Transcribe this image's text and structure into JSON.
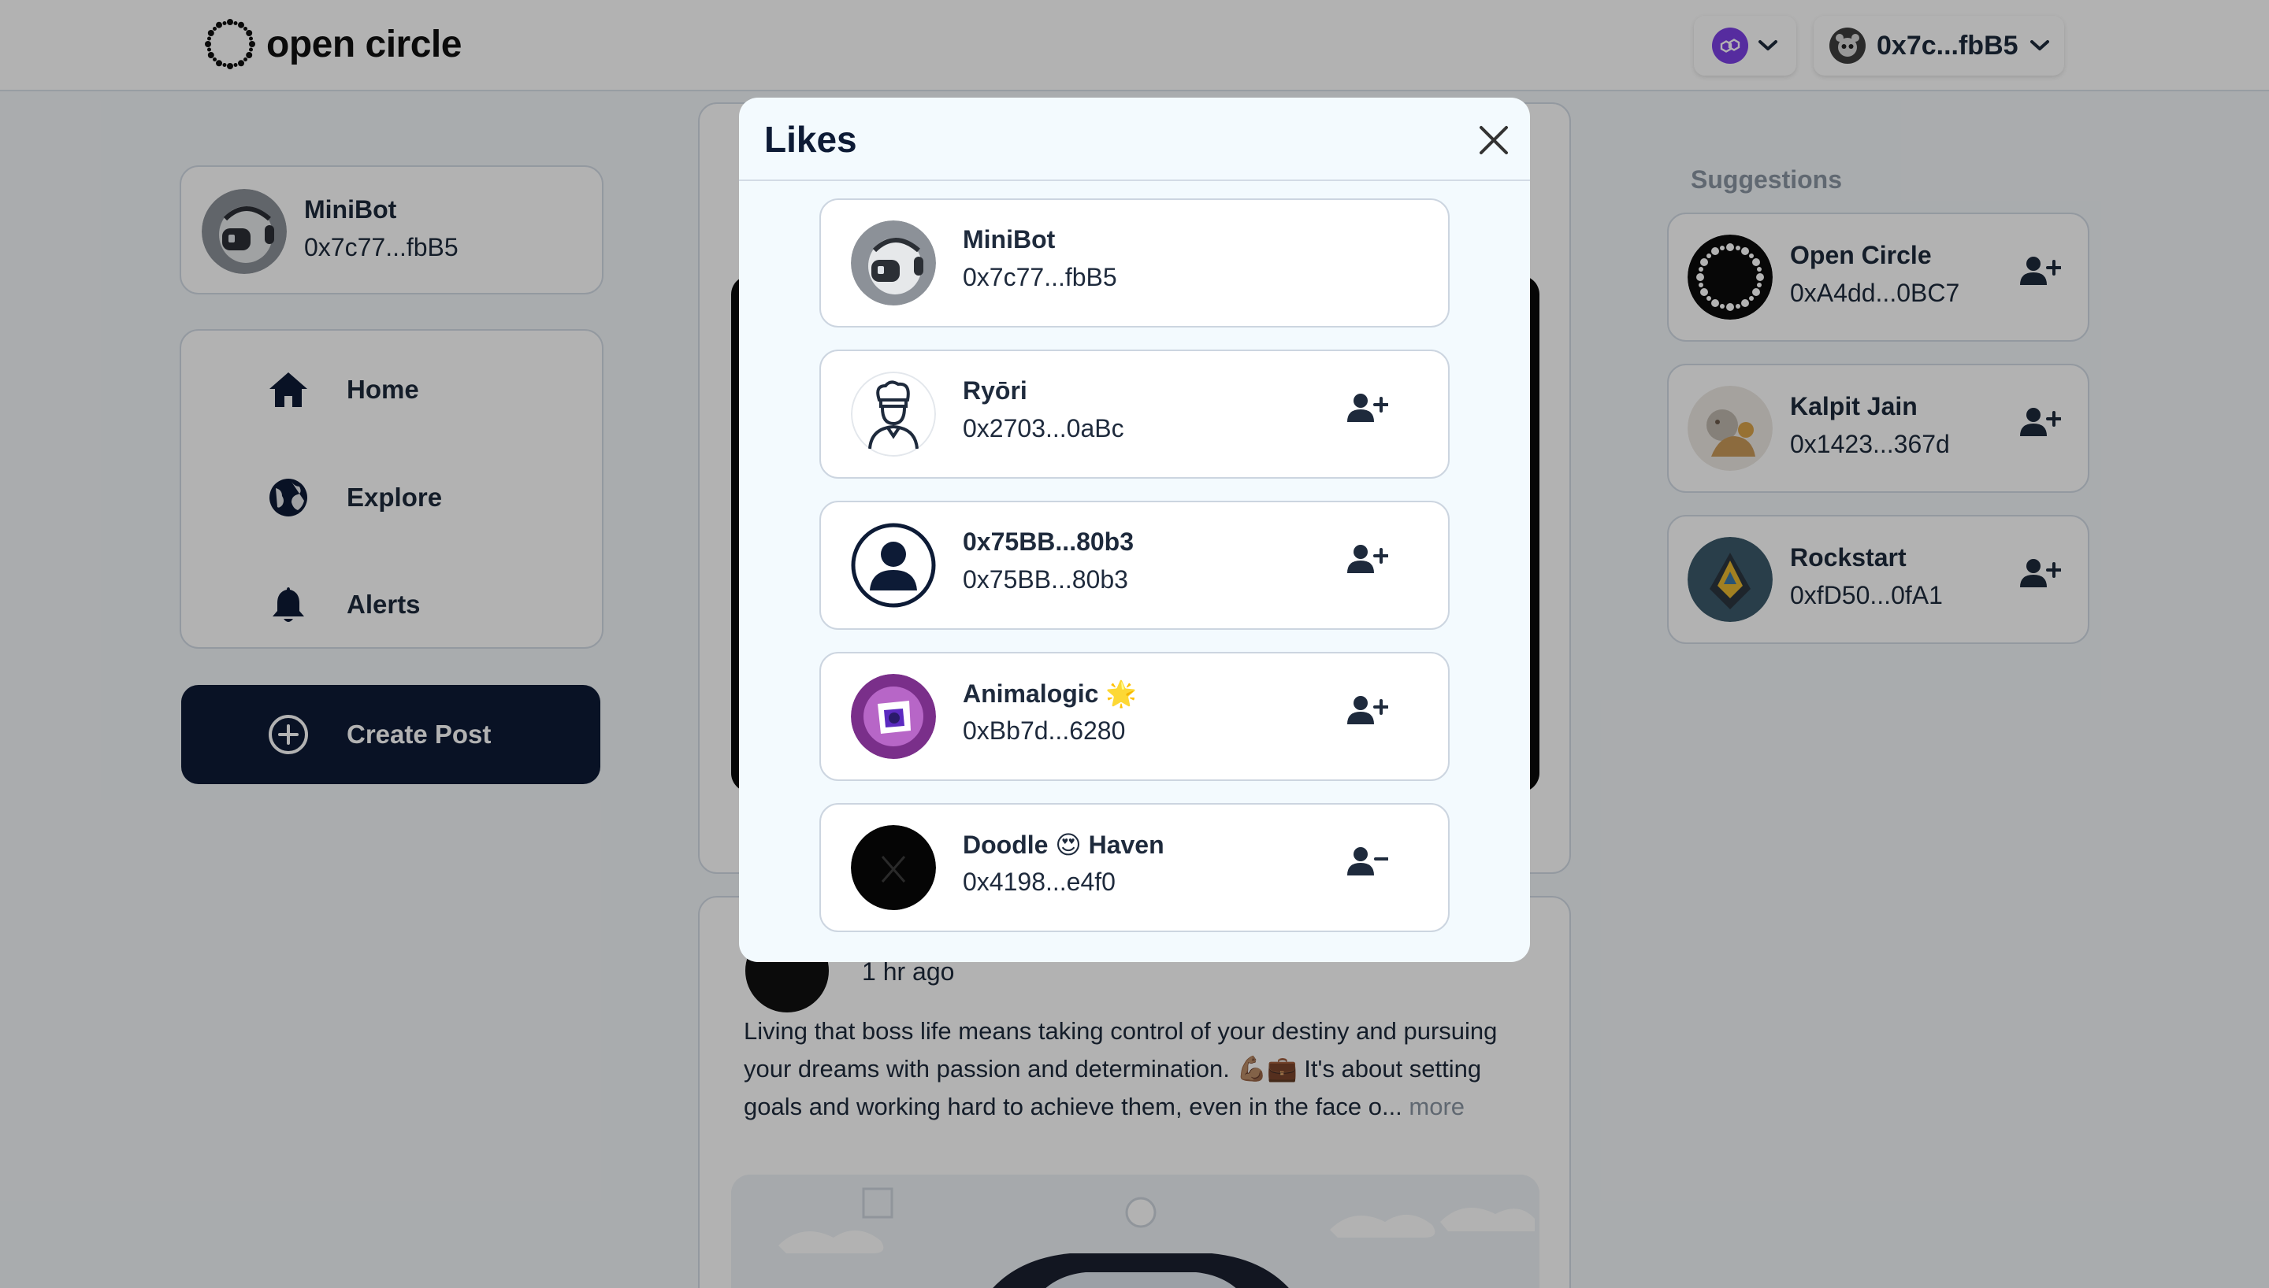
{
  "header": {
    "logo_text": "open circle",
    "account_address": "0x7c...fbB5"
  },
  "profile": {
    "name": "MiniBot",
    "address": "0x7c77...fbB5"
  },
  "nav": {
    "items": [
      {
        "label": "Home",
        "icon": "home-icon"
      },
      {
        "label": "Explore",
        "icon": "globe-icon"
      },
      {
        "label": "Alerts",
        "icon": "bell-icon"
      }
    ],
    "create_post_label": "Create Post"
  },
  "feed": {
    "post2": {
      "time": "1 hr ago",
      "text": "Living that boss life means taking control of your destiny and pursuing your dreams with passion and determination. 💪🏽💼 It's about setting goals and working hard to achieve them, even in the face o...",
      "more_label": "more"
    }
  },
  "suggestions": {
    "title": "Suggestions",
    "items": [
      {
        "name": "Open Circle",
        "address": "0xA4dd...0BC7"
      },
      {
        "name": "Kalpit Jain",
        "address": "0x1423...367d"
      },
      {
        "name": "Rockstart",
        "address": "0xfD50...0fA1"
      }
    ]
  },
  "modal": {
    "title": "Likes",
    "items": [
      {
        "name": "MiniBot",
        "address": "0x7c77...fbB5",
        "follow_state": "none"
      },
      {
        "name": "Ryōri",
        "address": "0x2703...0aBc",
        "follow_state": "follow"
      },
      {
        "name": "0x75BB...80b3",
        "address": "0x75BB...80b3",
        "follow_state": "follow"
      },
      {
        "name": "Animalogic 🌟",
        "address": "0xBb7d...6280",
        "follow_state": "follow"
      },
      {
        "name": "Doodle 😍 Haven",
        "address": "0x4198...e4f0",
        "follow_state": "unfollow"
      }
    ]
  },
  "colors": {
    "brand_dark": "#0d1b36",
    "text": "#1e2a3c",
    "muted": "#8a95a3",
    "chain_purple": "#7b3fe4"
  }
}
